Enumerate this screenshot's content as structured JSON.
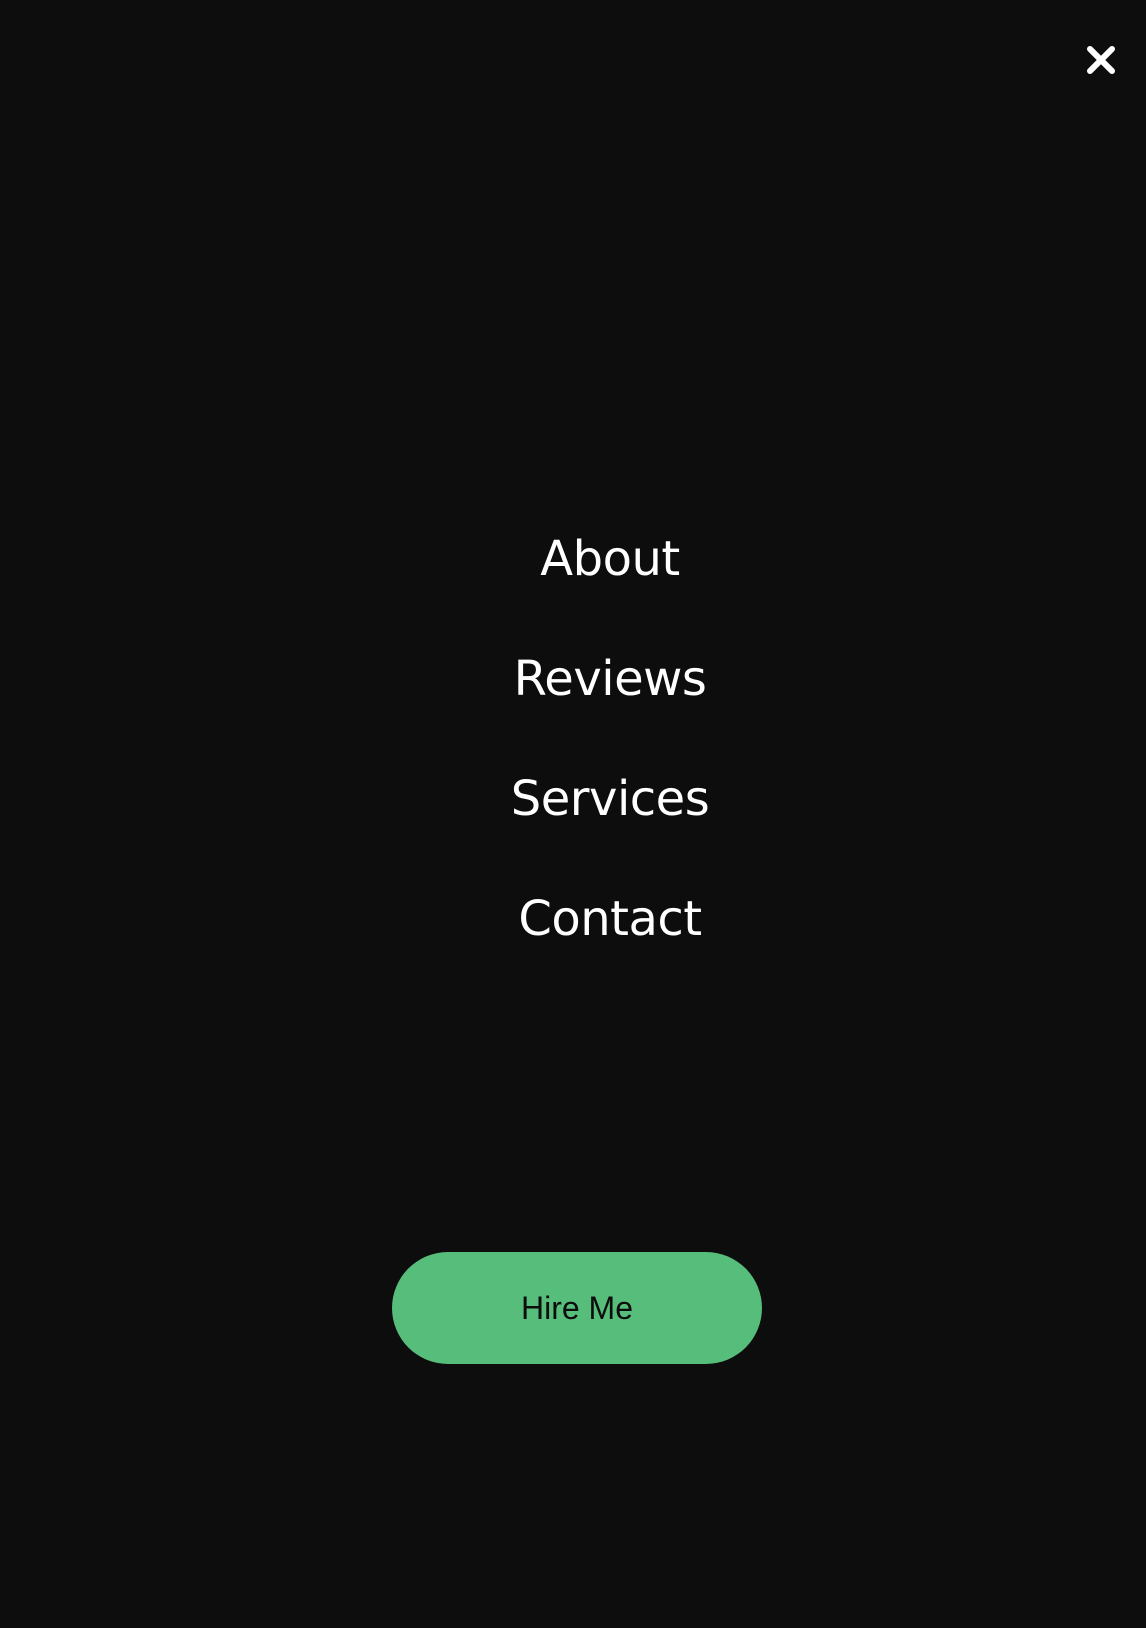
{
  "menu": {
    "close_icon": "close-icon",
    "items": [
      {
        "label": "About"
      },
      {
        "label": "Reviews"
      },
      {
        "label": "Services"
      },
      {
        "label": "Contact"
      }
    ],
    "cta_label": "Hire Me"
  },
  "colors": {
    "background": "#0d0d0d",
    "text": "#ffffff",
    "accent": "#56bd7a",
    "button_text": "#0d0d0d"
  }
}
